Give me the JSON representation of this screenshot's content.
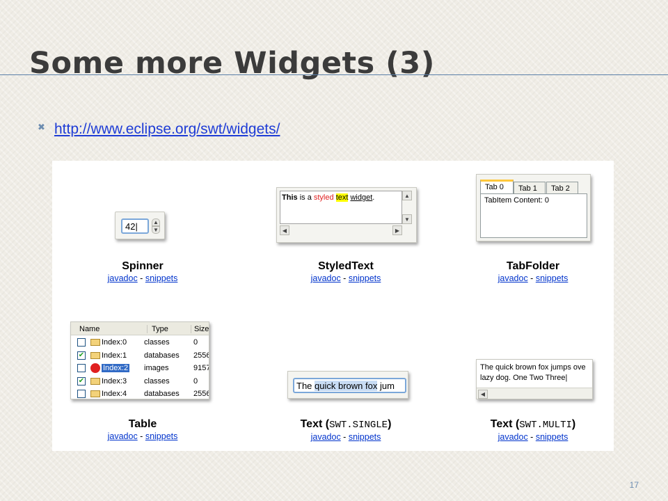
{
  "slide": {
    "title": "Some more Widgets (3)",
    "bullet_icon": "x-bullet-icon",
    "link": "http://www.eclipse.org/swt/widgets/",
    "page_number": "17"
  },
  "widgets": [
    {
      "name": "Spinner",
      "links": [
        "javadoc",
        "snippets"
      ],
      "value": "42"
    },
    {
      "name": "StyledText",
      "links": [
        "javadoc",
        "snippets"
      ],
      "parts": [
        "This",
        "is a",
        "styled",
        "text",
        "widget",
        "."
      ]
    },
    {
      "name": "TabFolder",
      "links": [
        "javadoc",
        "snippets"
      ],
      "tabs": [
        "Tab 0",
        "Tab 1",
        "Tab 2"
      ],
      "content": "TabItem Content: 0"
    },
    {
      "name": "Table",
      "links": [
        "javadoc",
        "snippets"
      ],
      "columns": [
        "Name",
        "Type",
        "Size"
      ],
      "rows": [
        [
          "Index:0",
          "classes",
          "0"
        ],
        [
          "Index:1",
          "databases",
          "2556"
        ],
        [
          "Index:2",
          "images",
          "9157"
        ],
        [
          "Index:3",
          "classes",
          "0"
        ],
        [
          "Index:4",
          "databases",
          "2556"
        ]
      ]
    },
    {
      "name": "Text (",
      "name_code": "SWT.SINGLE",
      "name_end": ")",
      "links": [
        "javadoc",
        "snippets"
      ],
      "text_before": "The ",
      "selected": "quick brown fox",
      "text_after": " jum"
    },
    {
      "name": "Text (",
      "name_code": "SWT.MULTI",
      "name_end": ")",
      "links": [
        "javadoc",
        "snippets"
      ],
      "lines": [
        "The quick brown fox jumps ove",
        "lazy dog.  One Two Three"
      ]
    }
  ],
  "separator": " - "
}
